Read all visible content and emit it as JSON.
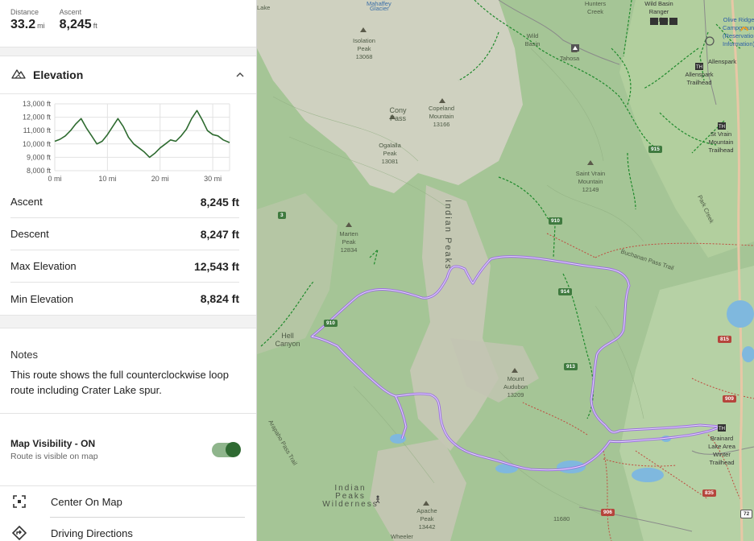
{
  "summary": {
    "distance_label": "Distance",
    "distance_value": "33.2",
    "distance_unit": "mi",
    "ascent_label": "Ascent",
    "ascent_value": "8,245",
    "ascent_unit": "ft"
  },
  "elevation": {
    "title": "Elevation",
    "icon": "mountain-icon",
    "collapse_icon": "chevron-up-icon",
    "y_ticks": [
      "13,000 ft",
      "12,000 ft",
      "11,000 ft",
      "10,000 ft",
      "9,000 ft",
      "8,000 ft"
    ],
    "x_ticks": [
      "0 mi",
      "10 mi",
      "20 mi",
      "30 mi"
    ],
    "line_color": "#2e6b30"
  },
  "chart_data": {
    "type": "line",
    "x": [
      0,
      1,
      2,
      3,
      4,
      5,
      6,
      7,
      8,
      9,
      10,
      11,
      12,
      13,
      14,
      15,
      16,
      17,
      18,
      19,
      20,
      21,
      22,
      23,
      24,
      25,
      26,
      27,
      28,
      29,
      30,
      31,
      32,
      33.2
    ],
    "y": [
      10200,
      10350,
      10600,
      11000,
      11500,
      11900,
      11200,
      10600,
      10000,
      10200,
      10700,
      11300,
      11900,
      11300,
      10500,
      10000,
      9700,
      9400,
      9000,
      9300,
      9700,
      10000,
      10300,
      10200,
      10600,
      11100,
      11900,
      12500,
      11800,
      11000,
      10700,
      10600,
      10300,
      10100
    ],
    "xlim": [
      0,
      33.2
    ],
    "ylim": [
      8000,
      13000
    ],
    "xticks": [
      "0 mi",
      "10 mi",
      "20 mi",
      "30 mi"
    ],
    "yticks": [
      "13,000 ft",
      "12,000 ft",
      "11,000 ft",
      "10,000 ft",
      "9,000 ft",
      "8,000 ft"
    ],
    "grid": true
  },
  "stats": [
    {
      "label": "Ascent",
      "value": "8,245 ft"
    },
    {
      "label": "Descent",
      "value": "8,247 ft"
    },
    {
      "label": "Max Elevation",
      "value": "12,543 ft"
    },
    {
      "label": "Min Elevation",
      "value": "8,824 ft"
    }
  ],
  "notes": {
    "heading": "Notes",
    "text": "This route shows the full counterclockwise loop route including Crater Lake spur."
  },
  "visibility": {
    "title": "Map Visibility - ON",
    "subtitle": "Route is visible on map",
    "enabled": true,
    "accent": "#2f6a32"
  },
  "actions": [
    {
      "label": "Center On Map",
      "icon": "center-focus-icon"
    },
    {
      "label": "Driving Directions",
      "icon": "directions-icon"
    }
  ],
  "map": {
    "route_color": "#9b6fe0",
    "labels": {
      "mahaffey": "Mahaffey",
      "glacier": "Glacier",
      "isolation": "Isolation Peak 13068",
      "cony_pass": "Cony Pass",
      "copeland": "Copeland Mountain 13166",
      "ogalalla": "Ogalalla Peak 13081",
      "indian_peaks": "Indian Peaks",
      "marten": "Marten Peak 12834",
      "hell_canyon": "Hell Canyon",
      "audubon": "Mount Audubon 13209",
      "saint_vrain": "Saint Vrain Mountain 12149",
      "buchanan": "Buchanan Pass Trail",
      "arapaho": "Arapaho Pass Trail",
      "ip_wilderness": "Indian Peaks Wilderness",
      "apache": "Apache Peak 13442",
      "wild_basin": "Wild Basin",
      "tahosa": "Tahosa",
      "hunters_creek": "Hunters Creek",
      "ranger_station": "Wild Basin Ranger Station",
      "allenspark": "Allenspark",
      "allenspark_th": "Allenspark Trailhead",
      "st_vrain_th": "St Vrain Mountain Trailhead",
      "olive_ridge": "Olive Ridge Campground (Reservations Information)",
      "park_creek": "Park Creek",
      "brainard": "Brainard Lake Area Winter Trailhead",
      "wheeler": "Wheeler",
      "lake": "Lake",
      "peak_11680": "11680"
    },
    "shields": [
      "915",
      "910",
      "3",
      "910",
      "914",
      "913",
      "815",
      "909",
      "835",
      "906",
      "72"
    ]
  }
}
